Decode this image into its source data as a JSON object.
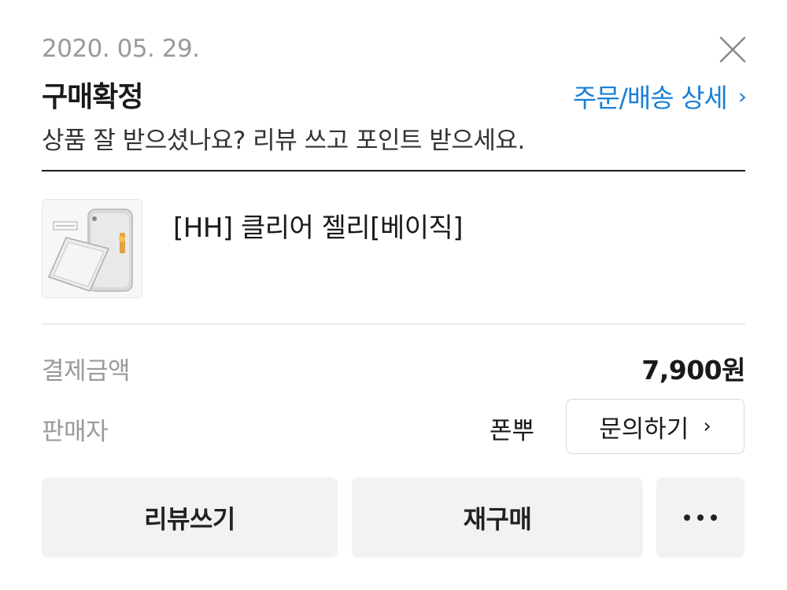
{
  "header": {
    "date": "2020. 05. 29.",
    "status_title": "구매확정",
    "detail_link_label": "주문/배송 상세",
    "subtitle": "상품 잘 받으셨나요? 리뷰 쓰고 포인트 받으세요.",
    "close_icon": "close-icon"
  },
  "product": {
    "name": "[HH] 클리어 젤리[베이직]",
    "thumbnail_icon": "phone-case-image"
  },
  "payment": {
    "label": "결제금액",
    "amount": "7,900원"
  },
  "seller": {
    "label": "판매자",
    "name": "폰뿌",
    "inquiry_button": "문의하기"
  },
  "actions": {
    "review_button": "리뷰쓰기",
    "rebuy_button": "재구매",
    "more_icon": "more-dots-icon"
  },
  "colors": {
    "accent_link": "#1a80d6",
    "button_bg": "#f2f2f2",
    "muted_text": "#9a9a9a"
  }
}
